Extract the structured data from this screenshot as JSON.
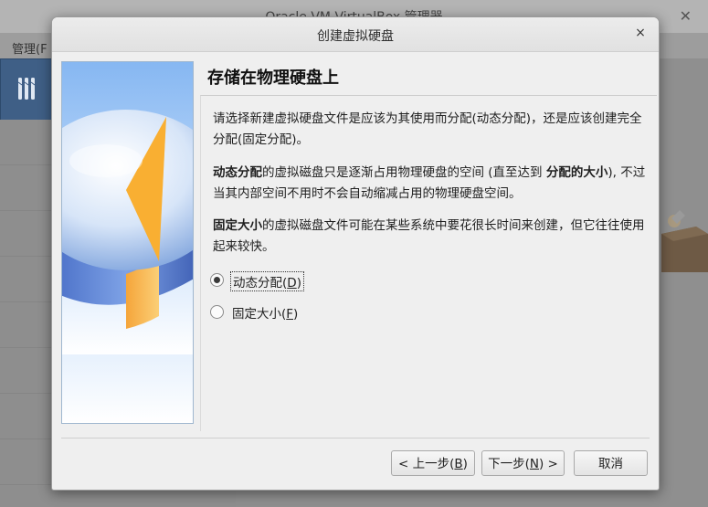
{
  "background_window": {
    "title": "Oracle VM VirtualBox 管理器",
    "close_glyph": "✕",
    "menu": {
      "item_label": "管理(F"
    }
  },
  "dialog": {
    "title": "创建虚拟硬盘",
    "close_glyph": "×",
    "heading": "存储在物理硬盘上",
    "para1": "请选择新建虚拟硬盘文件是应该为其使用而分配(动态分配)，还是应该创建完全分配(固定分配)。",
    "para2": {
      "bold1": "动态分配",
      "text1": "的虚拟磁盘只是逐渐占用物理硬盘的空间 (直至达到 ",
      "bold2": "分配的大小",
      "text2": "), 不过当其内部空间不用时不会自动缩减占用的物理硬盘空间。"
    },
    "para3": {
      "bold": "固定大小",
      "text": "的虚拟磁盘文件可能在某些系统中要花很长时间来创建，但它往往使用起来较快。"
    },
    "options": [
      {
        "label_pre": "动态分配(",
        "mnemonic": "D",
        "label_post": ")",
        "selected": true
      },
      {
        "label_pre": "固定大小(",
        "mnemonic": "F",
        "label_post": ")",
        "selected": false
      }
    ],
    "buttons": {
      "back": {
        "pre": "< 上一步(",
        "mnemonic": "B",
        "post": ")"
      },
      "next": {
        "pre": "下一步(",
        "mnemonic": "N",
        "post": ") >"
      },
      "cancel": "取消"
    },
    "icons": {
      "side_image": "hard-disk-illustration-icon",
      "tools": "tools-icon",
      "box": "package-box-icon"
    },
    "colors": {
      "disk_blue": "#5f8fd6",
      "pie_orange": "#f6a623",
      "side_border": "#9fb7cf",
      "tool_bg": "#3f5f86"
    }
  }
}
